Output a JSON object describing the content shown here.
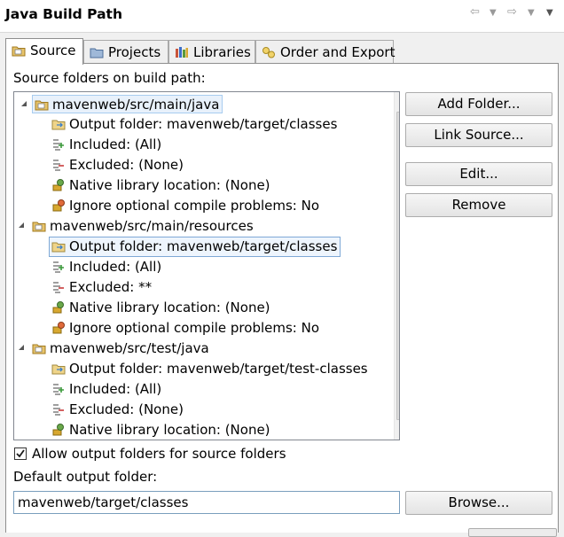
{
  "window": {
    "title": "Java Build Path"
  },
  "tabs": [
    {
      "label": "Source",
      "icon": "source-folder-icon",
      "active": true
    },
    {
      "label": "Projects",
      "icon": "projects-icon",
      "active": false
    },
    {
      "label": "Libraries",
      "icon": "libraries-icon",
      "active": false
    },
    {
      "label": "Order and Export",
      "icon": "order-export-icon",
      "active": false
    }
  ],
  "source": {
    "section_label": "Source folders on build path:",
    "tree": [
      {
        "label": "mavenweb/src/main/java",
        "children": [
          "Output folder: mavenweb/target/classes",
          "Included: (All)",
          "Excluded: (None)",
          "Native library location: (None)",
          "Ignore optional compile problems: No"
        ]
      },
      {
        "label": "mavenweb/src/main/resources",
        "children": [
          "Output folder: mavenweb/target/classes",
          "Included: (All)",
          "Excluded: **",
          "Native library location: (None)",
          "Ignore optional compile problems: No"
        ]
      },
      {
        "label": "mavenweb/src/test/java",
        "children": [
          "Output folder: mavenweb/target/test-classes",
          "Included: (All)",
          "Excluded: (None)",
          "Native library location: (None)"
        ]
      }
    ],
    "buttons": {
      "add_folder": "Add Folder...",
      "link_source": "Link Source...",
      "edit": "Edit...",
      "remove": "Remove"
    },
    "allow_output_folders": {
      "label": "Allow output folders for source folders",
      "checked": true
    },
    "default_output": {
      "label": "Default output folder:",
      "value": "mavenweb/target/classes",
      "browse": "Browse..."
    }
  }
}
